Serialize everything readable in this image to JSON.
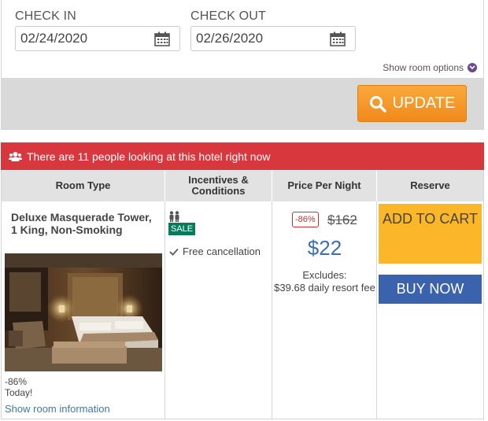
{
  "search": {
    "check_in_label": "CHECK IN",
    "check_in_value": "02/24/2020",
    "check_out_label": "CHECK OUT",
    "check_out_value": "02/26/2020",
    "room_options_link": "Show room options",
    "update_label": "UPDATE"
  },
  "alert": {
    "text": "There are 11 people looking at this hotel right now"
  },
  "table": {
    "headers": [
      "Room Type",
      "Incentives & Conditions",
      "Price Per Night",
      "Reserve"
    ],
    "room": {
      "name": "Deluxe Masquerade Tower, 1 King, Non-Smoking",
      "discount_line1": "-86%",
      "discount_line2": "Today!",
      "info_link": "Show room information",
      "sale_badge": "SALE",
      "free_cancellation": "Free cancellation",
      "pct_badge": "-86%",
      "old_price": "$162",
      "new_price": "$22",
      "excludes_line1": "Excludes:",
      "excludes_line2": "$39.68 daily resort fee",
      "add_to_cart": "ADD TO CART",
      "buy_now": "BUY NOW"
    }
  },
  "colors": {
    "update_orange": "#f39a2b",
    "alert_red": "#d9373e",
    "add_yellow": "#fbb629",
    "buy_blue": "#3a62ad",
    "sale_green": "#0a7a5c",
    "price_blue": "#3a6fb0"
  },
  "icons": [
    "calendar-icon",
    "chevron-down-icon",
    "search-icon",
    "users-icon",
    "guests-icon",
    "check-icon"
  ]
}
